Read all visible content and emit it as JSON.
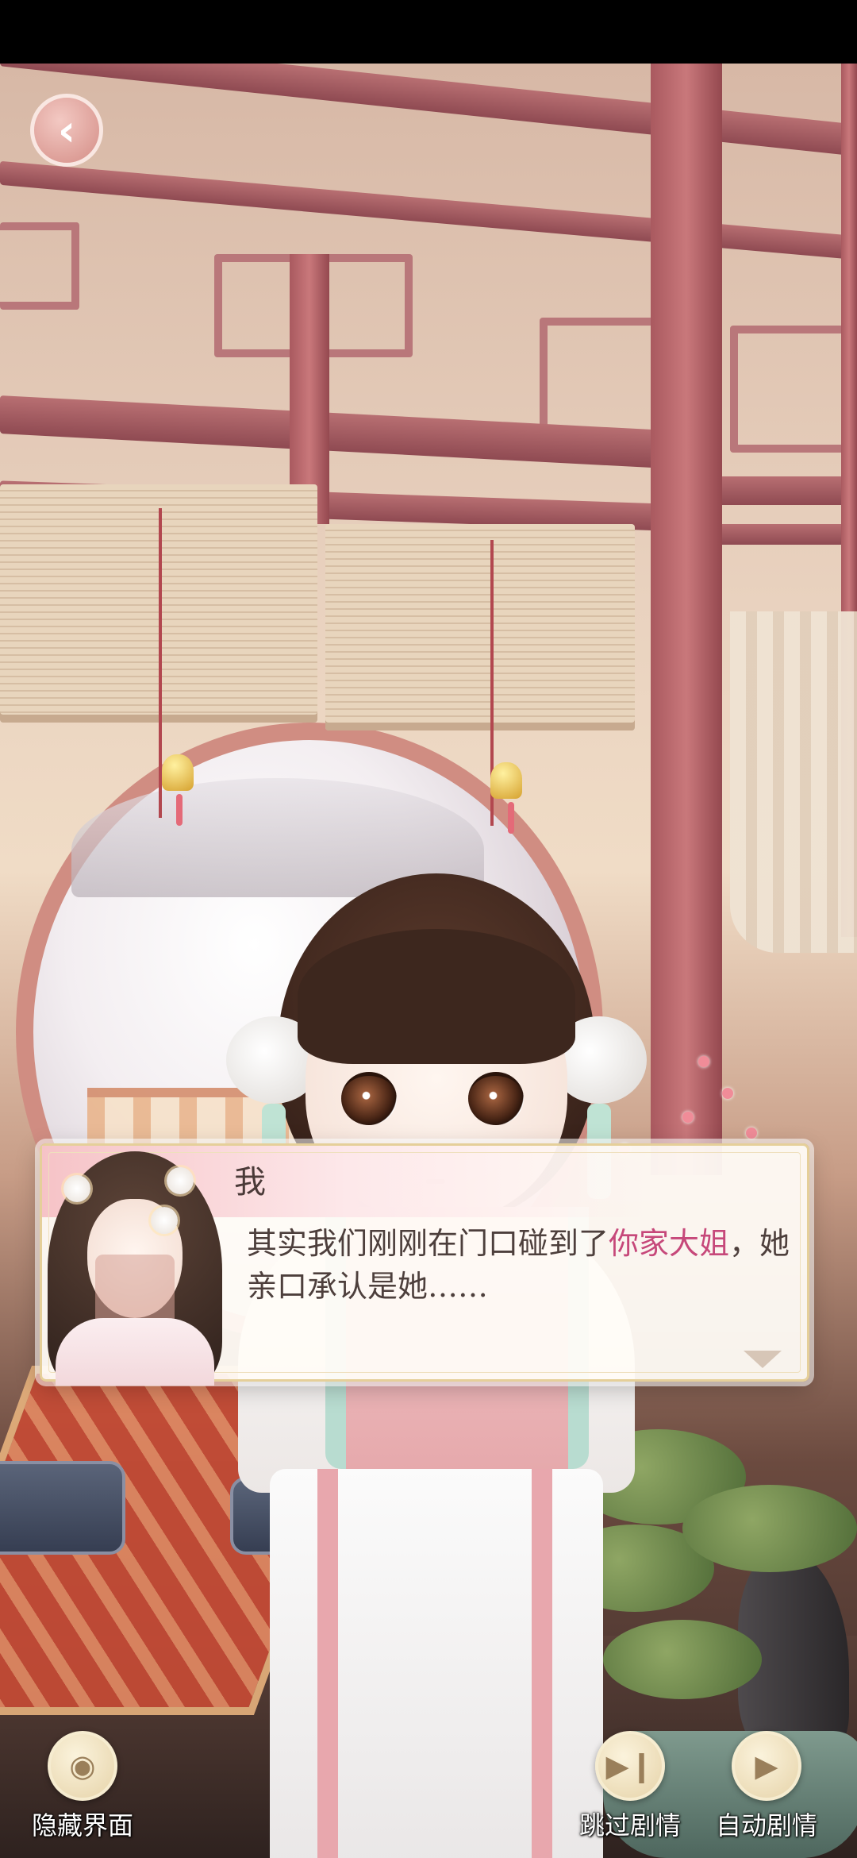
{
  "header": {
    "back_icon": "back-arrow-icon"
  },
  "dialog": {
    "speaker": "我",
    "text_before": "其实我们刚刚在门口碰到了",
    "text_highlight": "你家大姐",
    "text_after": "，她亲口承认是她……",
    "highlight_color": "#c6487a",
    "next_icon": "down-triangle-icon"
  },
  "controls": {
    "hide_ui": {
      "label": "隐藏界面",
      "icon": "eye-icon"
    },
    "skip": {
      "label": "跳过剧情",
      "icon": "skip-forward-icon"
    },
    "auto": {
      "label": "自动剧情",
      "icon": "play-icon"
    }
  }
}
